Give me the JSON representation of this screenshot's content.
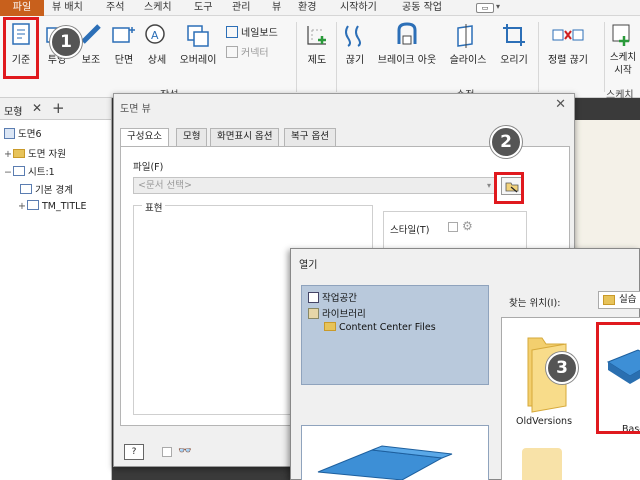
{
  "menubar": {
    "tabs": [
      "파일",
      "뷰 배치",
      "주석",
      "스케치",
      "도구",
      "관리",
      "뷰",
      "환경",
      "시작하기",
      "공동 작업"
    ],
    "active_tab": "파일",
    "accent": "#c8601c"
  },
  "ribbon": {
    "buttons": {
      "base": "기준",
      "projected": "투영",
      "auxiliary": "보조",
      "section": "단면",
      "detail": "상세",
      "overlay": "오버레이",
      "nailboard": "네일보드",
      "connector": "커넥터",
      "create": "제도",
      "break": "끊기",
      "breakout": "브레이크 아웃",
      "slice": "슬라이스",
      "crop": "오리기",
      "horizontal": "정렬 끊기",
      "start_sketch": "스케치 시작"
    },
    "groups": {
      "create": "작성",
      "modify": "수정",
      "sketch": "스케치"
    }
  },
  "callouts": [
    "1",
    "2",
    "3"
  ],
  "browser": {
    "tab": "모형",
    "tree": {
      "root": "도면6",
      "resources": "도면 자원",
      "sheet": "시트:1",
      "border": "기본 경계",
      "title": "TM_TITLE"
    }
  },
  "drawing_view": {
    "title": "도면 뷰",
    "tabs": [
      "구성요소",
      "모형",
      "화면표시 옵션",
      "복구 옵션"
    ],
    "file_label": "파일(F)",
    "file_placeholder": "<문서 선택>",
    "representation_label": "표현",
    "style_label": "스타일(T)"
  },
  "open_dialog": {
    "title": "열기",
    "locations": [
      "작업공간",
      "라이브러리",
      "Content Center Files"
    ],
    "look_in_label": "찾는 위치(I):",
    "look_in_value": "실습",
    "files": [
      "OldVersions",
      "Base"
    ]
  }
}
